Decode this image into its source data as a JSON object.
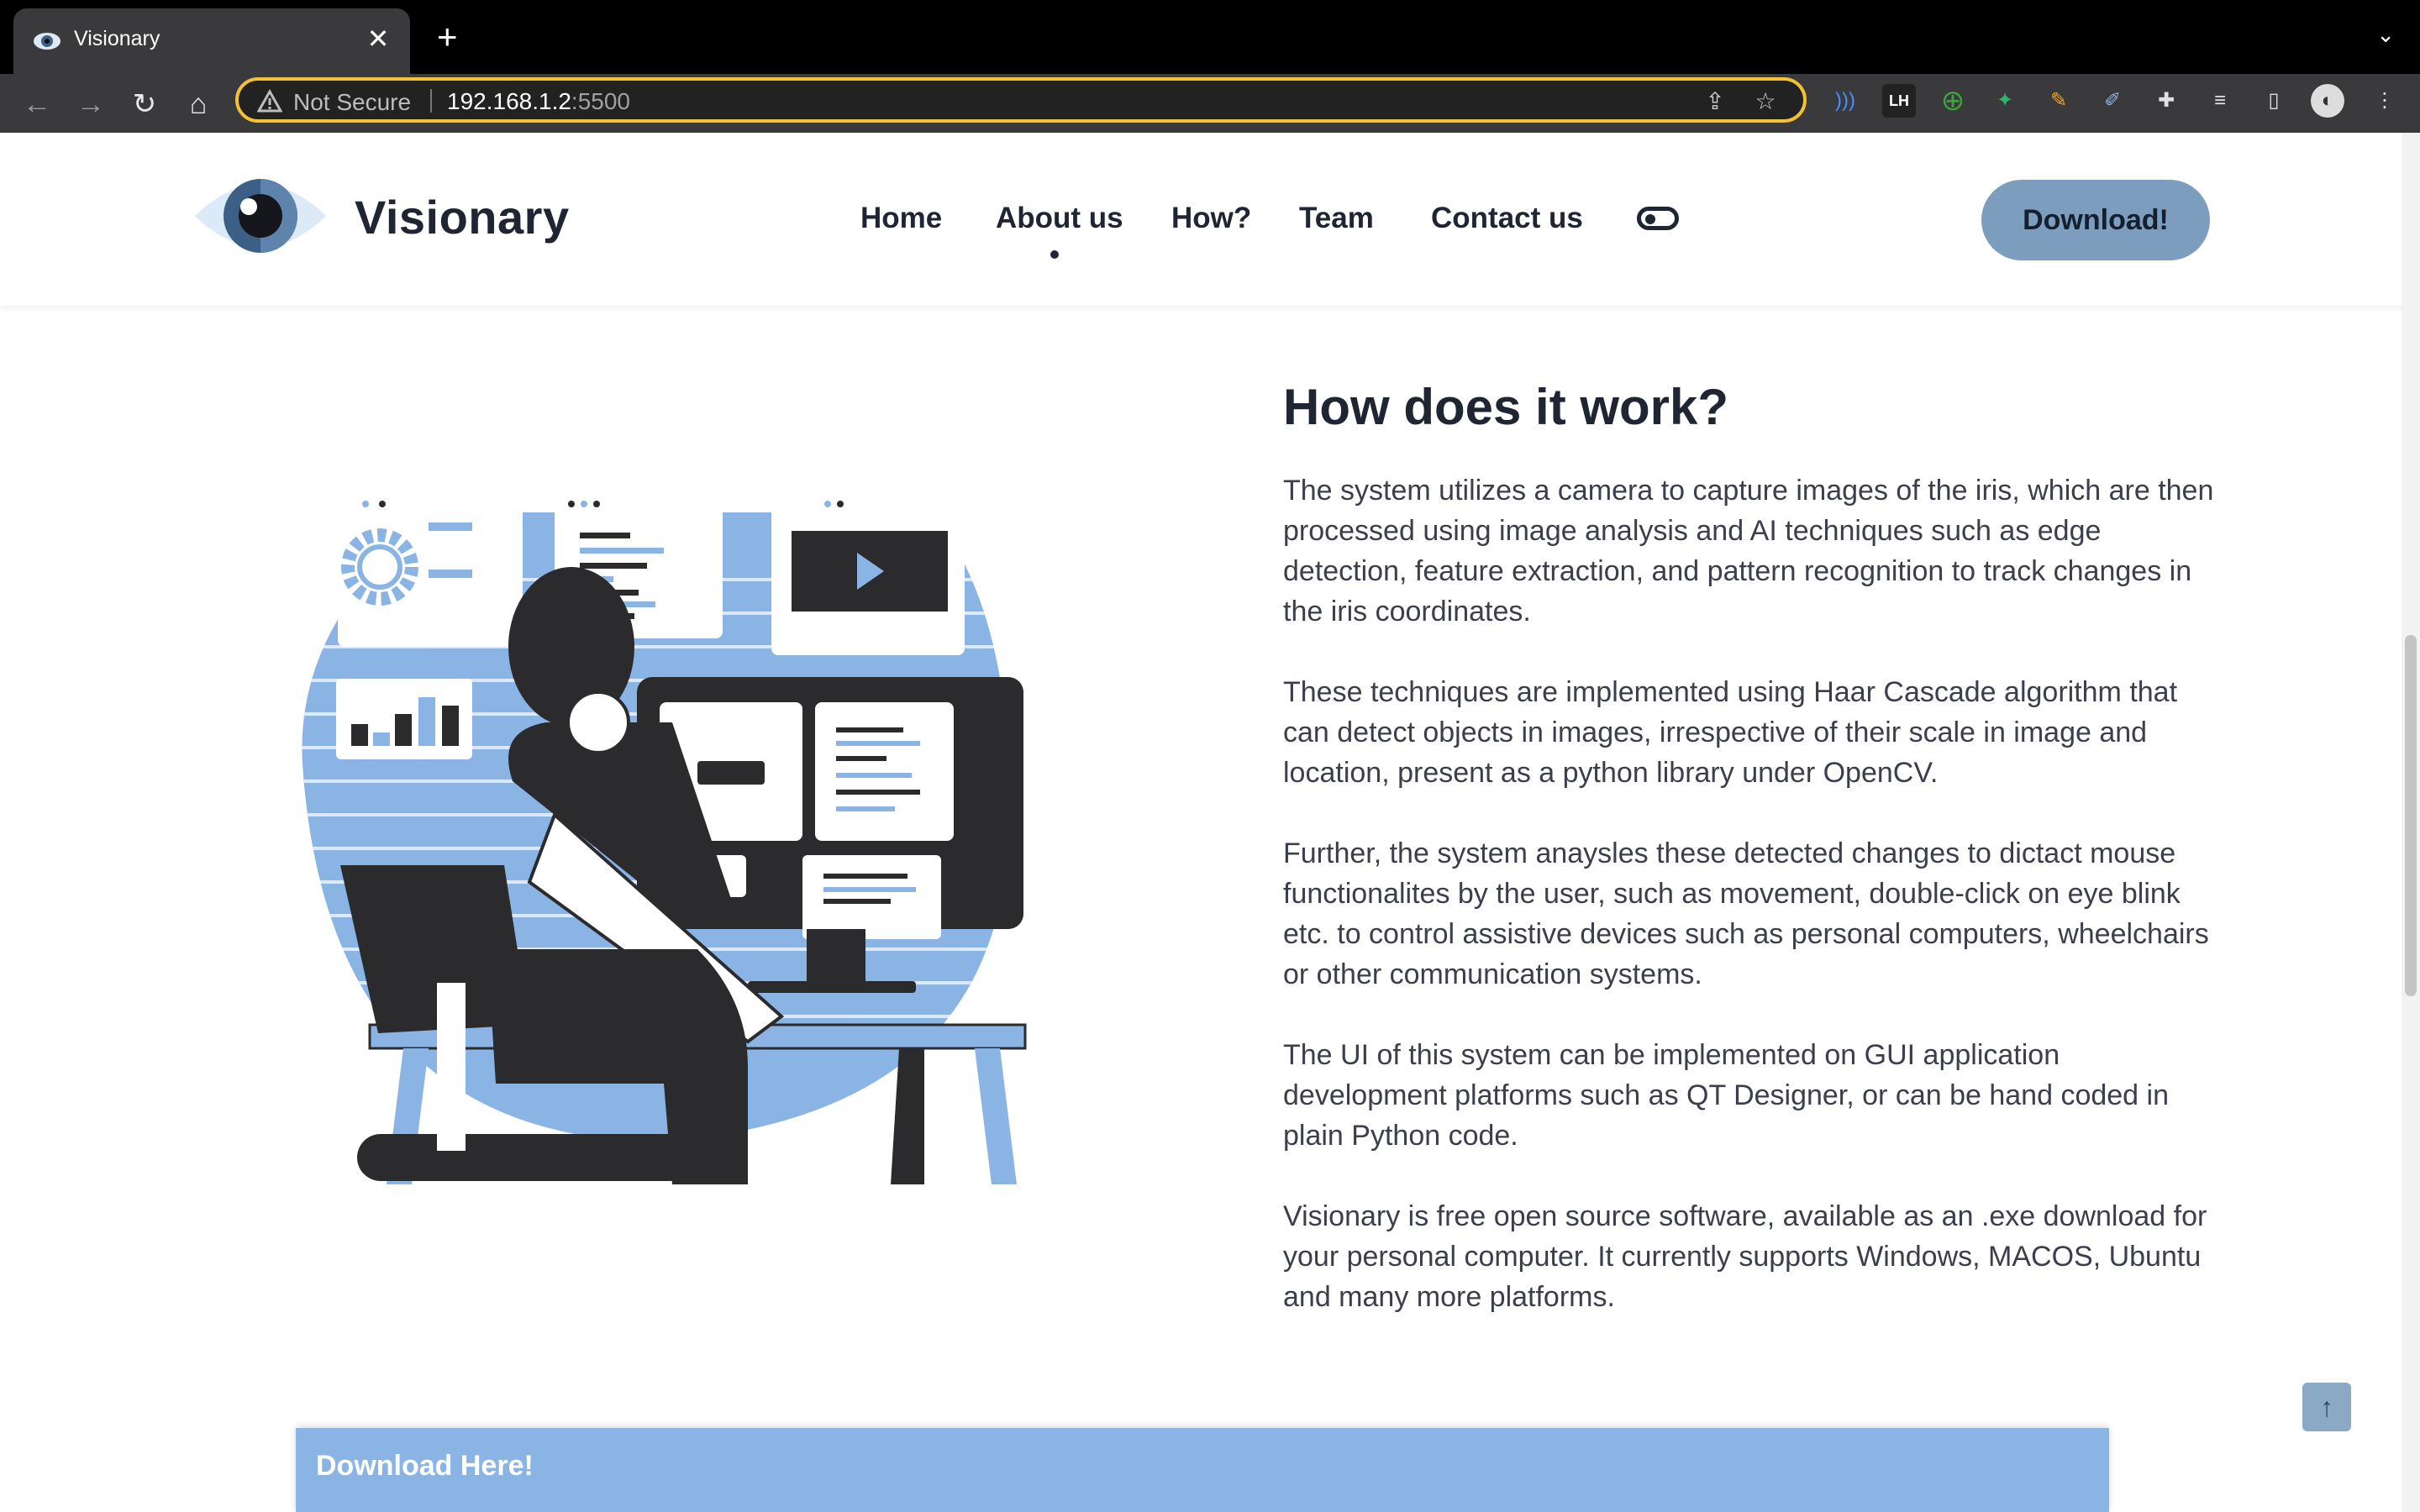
{
  "browser": {
    "tab_title": "Visionary",
    "tab_close": "✕",
    "new_tab": "+",
    "security_label": "Not Secure",
    "url_host": "192.168.1.2",
    "url_port": ":5500"
  },
  "site": {
    "brand": "Visionary",
    "nav": {
      "home": "Home",
      "about": "About us",
      "how": "How?",
      "team": "Team",
      "contact": "Contact us"
    },
    "download_button": "Download!"
  },
  "section": {
    "heading": "How does it work?",
    "paragraphs": [
      "The system utilizes a camera to capture images of the iris, which are then processed using image analysis and AI techniques such as edge detection, feature extraction, and pattern recognition to track changes in the iris coordinates.",
      "These techniques are implemented using Haar Cascade algorithm that can detect objects in images, irrespective of their scale in image and location, present as a python library under OpenCV.",
      "Further, the system anaysles these detected changes to dictact mouse functionalites by the user, such as movement, double-click on eye blink etc. to control assistive devices such as personal computers, wheelchairs or other communication systems.",
      "The UI of this system can be implemented on GUI application development platforms such as QT Designer, or can be hand coded in plain Python code.",
      "Visionary is free open source software, available as an .exe download for your personal computer. It currently supports Windows, MACOS, Ubuntu and many more platforms."
    ]
  },
  "download_bar": {
    "label": "Download Here!"
  },
  "colors": {
    "accent": "#8ab4e4",
    "button": "#7c9dbd",
    "text_dark": "#1f2533"
  }
}
